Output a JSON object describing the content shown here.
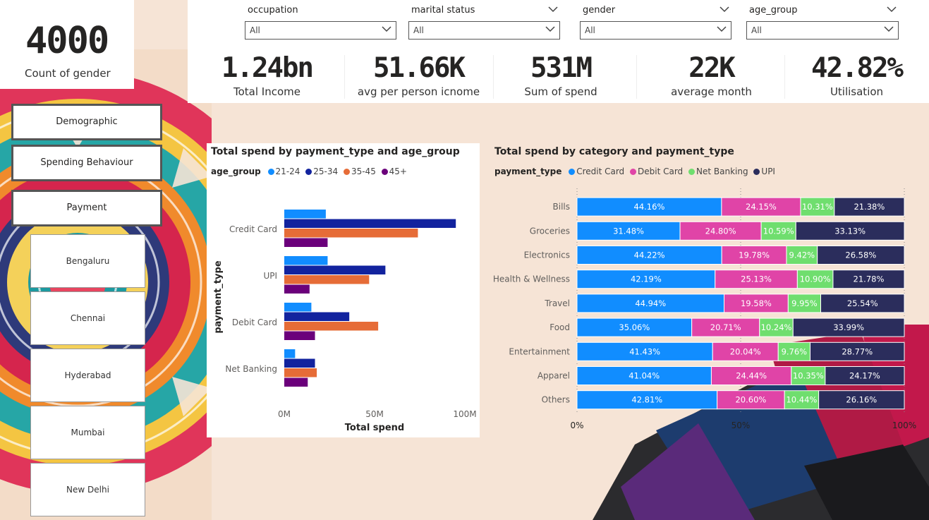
{
  "count_card": {
    "value": "4000",
    "label": "Count of gender"
  },
  "filters": [
    {
      "title": "occupation",
      "value": "All"
    },
    {
      "title": "marital status",
      "value": "All"
    },
    {
      "title": "gender",
      "value": "All"
    },
    {
      "title": "age_group",
      "value": "All"
    }
  ],
  "kpis": [
    {
      "value": "1.24bn",
      "label": "Total Income"
    },
    {
      "value": "51.66K",
      "label": "avg per person icnome"
    },
    {
      "value": "531M",
      "label": "Sum of spend"
    },
    {
      "value": "22K",
      "label": "average month"
    },
    {
      "value": "42.82%",
      "label": "Utilisation"
    }
  ],
  "nav": {
    "demographic": "Demographic",
    "spending": "Spending Behaviour",
    "payment": "Payment",
    "cities": [
      "Bengaluru",
      "Chennai",
      "Hyderabad",
      "Mumbai",
      "New Delhi"
    ]
  },
  "colors": {
    "c_2124": "#118DFF",
    "c_2534": "#12239E",
    "c_3545": "#E66C37",
    "c_45": "#6B007B",
    "credit": "#118DFF",
    "debit": "#E044A7",
    "netbanking": "#6FDE6E",
    "upi": "#2B2D5C"
  },
  "chart_data": [
    {
      "type": "bar",
      "orientation": "horizontal",
      "title": "Total spend by payment_type and age_group",
      "legend_title": "age_group",
      "xlabel": "Total spend",
      "ylabel": "payment_type",
      "categories": [
        "Credit Card",
        "UPI",
        "Debit Card",
        "Net Banking"
      ],
      "series": [
        {
          "name": "21-24",
          "values": [
            23,
            24,
            15,
            6
          ]
        },
        {
          "name": "25-34",
          "values": [
            95,
            56,
            36,
            17
          ]
        },
        {
          "name": "35-45",
          "values": [
            74,
            47,
            52,
            18
          ]
        },
        {
          "name": "45+",
          "values": [
            24,
            14,
            17,
            13
          ]
        }
      ],
      "value_unit": "M",
      "xlim": [
        0,
        100
      ],
      "x_ticks": [
        "0M",
        "50M",
        "100M"
      ],
      "grid": false,
      "legend_position": "top"
    },
    {
      "type": "bar",
      "orientation": "horizontal",
      "stacked": "100%",
      "title": "Total spend by category and payment_type",
      "legend_title": "payment_type",
      "categories": [
        "Bills",
        "Groceries",
        "Electronics",
        "Health & Wellness",
        "Travel",
        "Food",
        "Entertainment",
        "Apparel",
        "Others"
      ],
      "series": [
        {
          "name": "Credit Card",
          "values": [
            44.16,
            31.48,
            44.22,
            42.19,
            44.94,
            35.06,
            41.43,
            41.04,
            42.81
          ]
        },
        {
          "name": "Debit Card",
          "values": [
            24.15,
            24.8,
            19.78,
            25.13,
            19.58,
            20.71,
            20.04,
            24.44,
            20.6
          ]
        },
        {
          "name": "Net Banking",
          "values": [
            10.31,
            10.59,
            9.42,
            10.9,
            9.95,
            10.24,
            9.76,
            10.35,
            10.44
          ]
        },
        {
          "name": "UPI",
          "values": [
            21.38,
            33.13,
            26.58,
            21.78,
            25.54,
            33.99,
            28.77,
            24.17,
            26.16
          ]
        }
      ],
      "x_ticks": [
        "0%",
        "50%",
        "100%"
      ],
      "xlim": [
        0,
        100
      ],
      "grid": true,
      "legend_position": "top"
    }
  ]
}
